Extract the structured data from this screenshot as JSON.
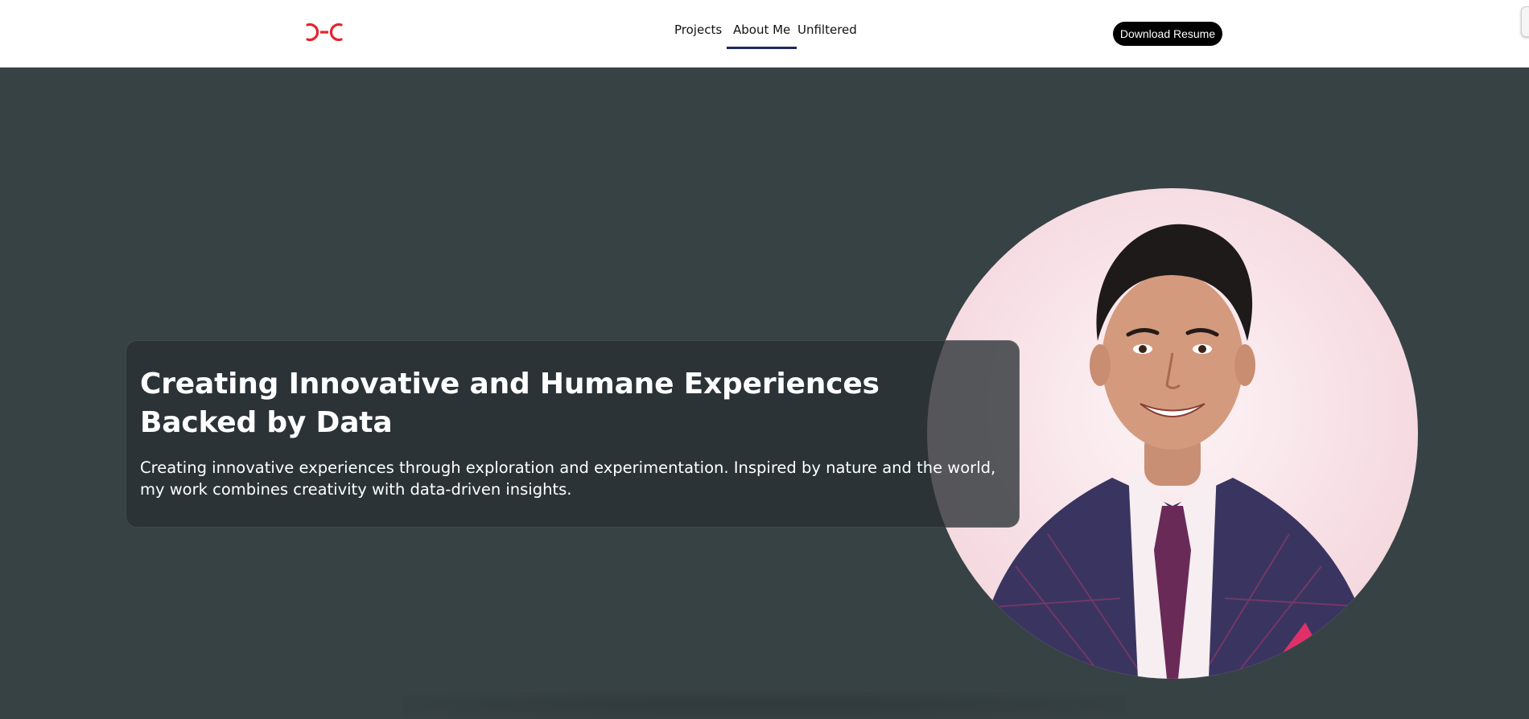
{
  "header": {
    "logo_icon": "interlocking-c-logo",
    "logo_color": "#e5242d",
    "nav": [
      {
        "label": "Projects"
      },
      {
        "label": "About Me",
        "active": true
      },
      {
        "label": "Unfiltered"
      }
    ],
    "resume_button": "Download Resume"
  },
  "hero": {
    "title": "Creating Innovative and Humane Experiences Backed by Data",
    "subtitle": "Creating innovative experiences through exploration and experimentation. Inspired by nature and the world, my work combines creativity with data-driven insights.",
    "portrait_icon": "profile-portrait",
    "background_color": "#374245",
    "accent_color": "#1e2a5e"
  }
}
